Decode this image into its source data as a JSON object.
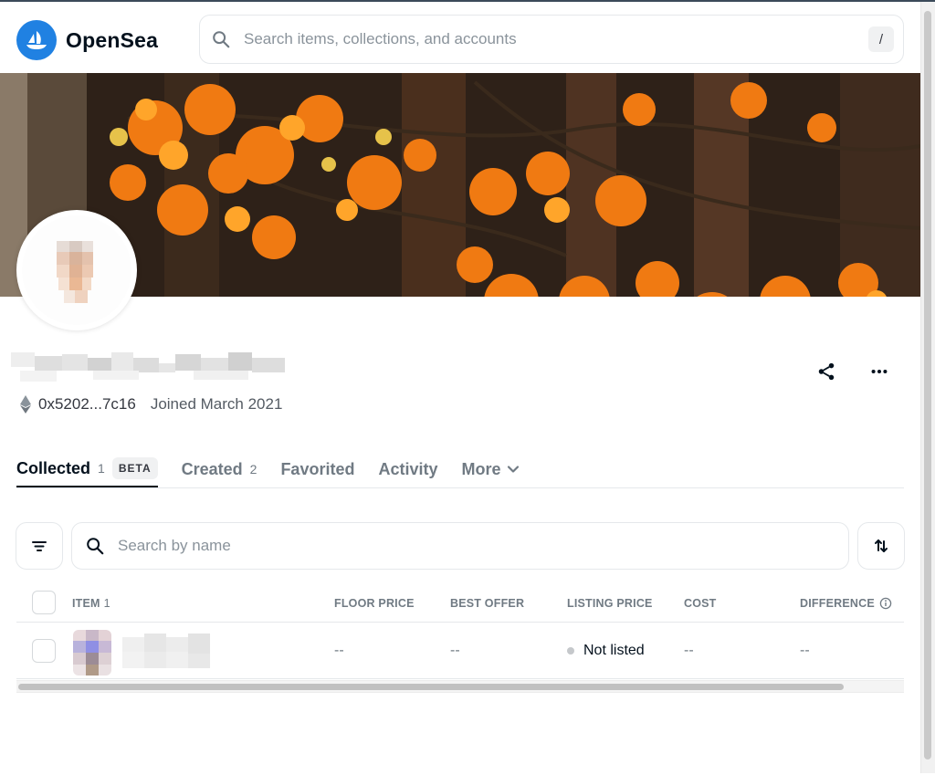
{
  "header": {
    "brand": "OpenSea",
    "search_placeholder": "Search items, collections, and accounts",
    "search_shortcut": "/"
  },
  "profile": {
    "address": "0x5202...7c16",
    "joined": "Joined March 2021"
  },
  "tabs": [
    {
      "label": "Collected",
      "count": "1",
      "badge": "BETA"
    },
    {
      "label": "Created",
      "count": "2"
    },
    {
      "label": "Favorited"
    },
    {
      "label": "Activity"
    },
    {
      "label": "More"
    }
  ],
  "filter": {
    "search_placeholder": "Search by name"
  },
  "table": {
    "columns": {
      "item": "ITEM",
      "item_count": "1",
      "floor_price": "FLOOR PRICE",
      "best_offer": "BEST OFFER",
      "listing_price": "LISTING PRICE",
      "cost": "COST",
      "difference": "DIFFERENCE"
    },
    "rows": [
      {
        "floor_price": "--",
        "best_offer": "--",
        "listing_price": "Not listed",
        "cost": "--",
        "difference": "--"
      }
    ]
  },
  "colors": {
    "brand_blue": "#2081e2",
    "text_primary": "#04111d",
    "text_secondary": "#707a83",
    "border": "#e5e8eb"
  }
}
